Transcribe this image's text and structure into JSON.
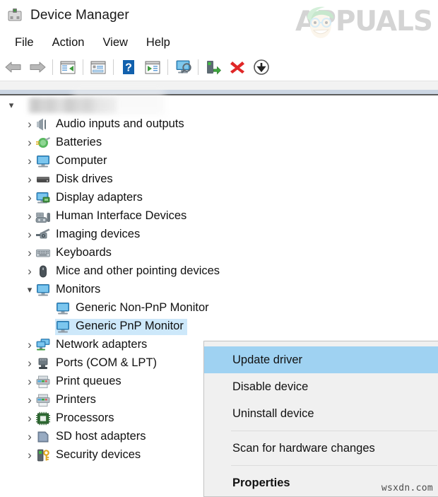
{
  "window": {
    "title": "Device Manager",
    "icon": "device-manager-icon"
  },
  "branding": {
    "logo_text": "APPUALS",
    "watermark": "wsxdn.com"
  },
  "menubar": {
    "items": [
      {
        "label": "File",
        "name": "menu-file"
      },
      {
        "label": "Action",
        "name": "menu-action"
      },
      {
        "label": "View",
        "name": "menu-view"
      },
      {
        "label": "Help",
        "name": "menu-help"
      }
    ]
  },
  "toolbar": {
    "buttons": [
      {
        "name": "back-icon",
        "tip": "Back"
      },
      {
        "name": "forward-icon",
        "tip": "Forward"
      },
      {
        "name": "show-hide-console-tree-icon",
        "tip": "Show/Hide Console Tree"
      },
      {
        "name": "properties-icon",
        "tip": "Properties"
      },
      {
        "name": "help-icon",
        "tip": "Help"
      },
      {
        "name": "update-driver-icon",
        "tip": "Update Driver Software"
      },
      {
        "name": "scan-for-hardware-changes-icon",
        "tip": "Scan for hardware changes"
      },
      {
        "name": "enable-device-icon",
        "tip": "Enable device"
      },
      {
        "name": "uninstall-device-icon",
        "tip": "Uninstall device"
      },
      {
        "name": "disable-device-icon",
        "tip": "Disable device"
      }
    ]
  },
  "tree": {
    "root": {
      "label": "",
      "redacted": true,
      "expanded": true
    },
    "items": [
      {
        "label": "Audio inputs and outputs",
        "icon": "speaker-icon",
        "expandable": true,
        "expanded": false,
        "depth": 1
      },
      {
        "label": "Batteries",
        "icon": "battery-icon",
        "expandable": true,
        "expanded": false,
        "depth": 1
      },
      {
        "label": "Computer",
        "icon": "computer-icon",
        "expandable": true,
        "expanded": false,
        "depth": 1
      },
      {
        "label": "Disk drives",
        "icon": "disk-drive-icon",
        "expandable": true,
        "expanded": false,
        "depth": 1
      },
      {
        "label": "Display adapters",
        "icon": "display-adapter-icon",
        "expandable": true,
        "expanded": false,
        "depth": 1
      },
      {
        "label": "Human Interface Devices",
        "icon": "hid-icon",
        "expandable": true,
        "expanded": false,
        "depth": 1
      },
      {
        "label": "Imaging devices",
        "icon": "camera-icon",
        "expandable": true,
        "expanded": false,
        "depth": 1
      },
      {
        "label": "Keyboards",
        "icon": "keyboard-icon",
        "expandable": true,
        "expanded": false,
        "depth": 1
      },
      {
        "label": "Mice and other pointing devices",
        "icon": "mouse-icon",
        "expandable": true,
        "expanded": false,
        "depth": 1
      },
      {
        "label": "Monitors",
        "icon": "monitor-icon",
        "expandable": true,
        "expanded": true,
        "depth": 1
      },
      {
        "label": "Generic Non-PnP Monitor",
        "icon": "monitor-icon",
        "expandable": false,
        "expanded": false,
        "depth": 2,
        "selected": false
      },
      {
        "label": "Generic PnP Monitor",
        "icon": "monitor-icon",
        "expandable": false,
        "expanded": false,
        "depth": 2,
        "selected": true
      },
      {
        "label": "Network adapters",
        "icon": "network-adapter-icon",
        "expandable": true,
        "expanded": false,
        "depth": 1
      },
      {
        "label": "Ports (COM & LPT)",
        "icon": "port-icon",
        "expandable": true,
        "expanded": false,
        "depth": 1
      },
      {
        "label": "Print queues",
        "icon": "printer-icon",
        "expandable": true,
        "expanded": false,
        "depth": 1
      },
      {
        "label": "Printers",
        "icon": "printer-icon",
        "expandable": true,
        "expanded": false,
        "depth": 1
      },
      {
        "label": "Processors",
        "icon": "processor-icon",
        "expandable": true,
        "expanded": false,
        "depth": 1
      },
      {
        "label": "SD host adapters",
        "icon": "sd-host-adapter-icon",
        "expandable": true,
        "expanded": false,
        "depth": 1
      },
      {
        "label": "Security devices",
        "icon": "security-device-icon",
        "expandable": true,
        "expanded": false,
        "depth": 1
      }
    ]
  },
  "context_menu": {
    "items": [
      {
        "label": "Update driver",
        "name": "ctx-update-driver",
        "highlighted": true,
        "bold": false
      },
      {
        "label": "Disable device",
        "name": "ctx-disable-device",
        "highlighted": false,
        "bold": false
      },
      {
        "label": "Uninstall device",
        "name": "ctx-uninstall-device",
        "highlighted": false,
        "bold": false
      },
      {
        "label": "Scan for hardware changes",
        "name": "ctx-scan-hardware",
        "highlighted": false,
        "bold": false
      },
      {
        "label": "Properties",
        "name": "ctx-properties",
        "highlighted": false,
        "bold": true
      }
    ]
  },
  "colors": {
    "selection": "#cde8fa",
    "menu_highlight": "#9fd2f2",
    "menu_bg": "#f0f0f0",
    "accent_blue": "#4aa3df"
  }
}
